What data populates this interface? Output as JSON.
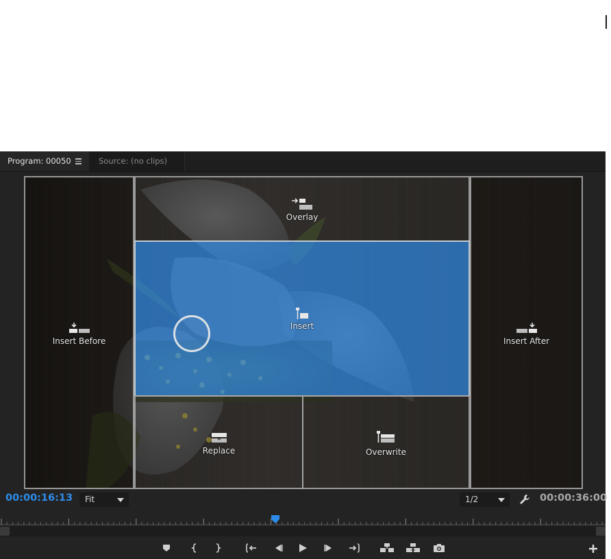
{
  "panel": {
    "tabs": [
      {
        "label": "Program: 00050",
        "active": true
      },
      {
        "label": "Source: (no clips)",
        "active": false
      }
    ]
  },
  "drop_zones": {
    "insert_before": "Insert Before",
    "overlay": "Overlay",
    "insert": "Insert",
    "insert_after": "Insert After",
    "replace": "Replace",
    "overwrite": "Overwrite",
    "active_zone": "insert"
  },
  "controls": {
    "current_time": "00:00:16:13",
    "duration": "00:00:36:00",
    "zoom_select": "Fit",
    "resolution_select": "1/2"
  },
  "transport_buttons": [
    "add-marker-icon",
    "mark-in-icon",
    "mark-out-icon",
    "go-to-in-icon",
    "step-back-icon",
    "play-icon",
    "step-forward-icon",
    "go-to-out-icon",
    "lift-icon",
    "extract-icon",
    "export-frame-icon"
  ],
  "colors": {
    "accent": "#2d8ceb",
    "active_zone": "#2e80d4",
    "panel_bg": "#232323"
  }
}
